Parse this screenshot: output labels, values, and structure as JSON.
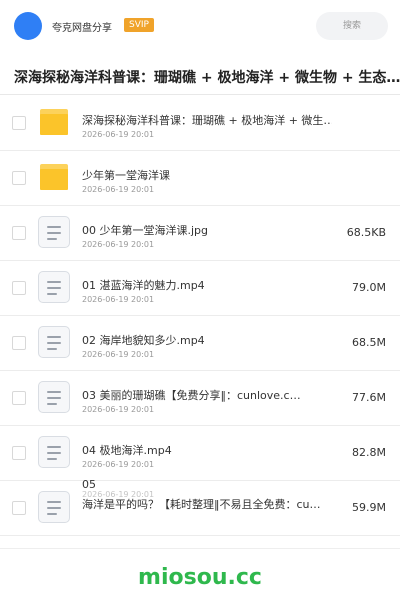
{
  "header": {
    "username": "夸克网盘分享",
    "vip_badge": "SVIP",
    "search_placeholder": "搜索"
  },
  "page_title": "深海探秘海洋科普课：珊瑚礁 + 极地海洋 + 微生物 + 生态…",
  "files": [
    {
      "name": "深海探秘海洋科普课：珊瑚礁 + 极地海洋 + 微生…",
      "date": "2026-06-19 20:01",
      "size": "",
      "type": "folder"
    },
    {
      "name": "少年第一堂海洋课",
      "date": "2026-06-19 20:01",
      "size": "",
      "type": "folder"
    },
    {
      "name": "00 少年第一堂海洋课.jpg",
      "date": "2026-06-19 20:01",
      "size": "68.5KB",
      "type": "file"
    },
    {
      "name": "01 湛蓝海洋的魅力.mp4",
      "date": "2026-06-19 20:01",
      "size": "79.0M",
      "type": "file"
    },
    {
      "name": "02 海岸地貌知多少.mp4",
      "date": "2026-06-19 20:01",
      "size": "68.5M",
      "type": "file"
    },
    {
      "name": "03 美丽的珊瑚礁【免费分享‖：cunlove.c…",
      "date": "2026-06-19 20:01",
      "size": "77.6M",
      "type": "file"
    },
    {
      "name": "04 极地海洋.mp4",
      "date": "2026-06-19 20:01",
      "size": "82.8M",
      "type": "file"
    }
  ],
  "last_file": {
    "name_line1": "05",
    "name_line2": "海洋是平的吗？【耗时整理‖不易且全免费：cu…",
    "date": "2026-06-19 20:01",
    "size": "59.9M"
  },
  "watermark": "miosou.cc"
}
